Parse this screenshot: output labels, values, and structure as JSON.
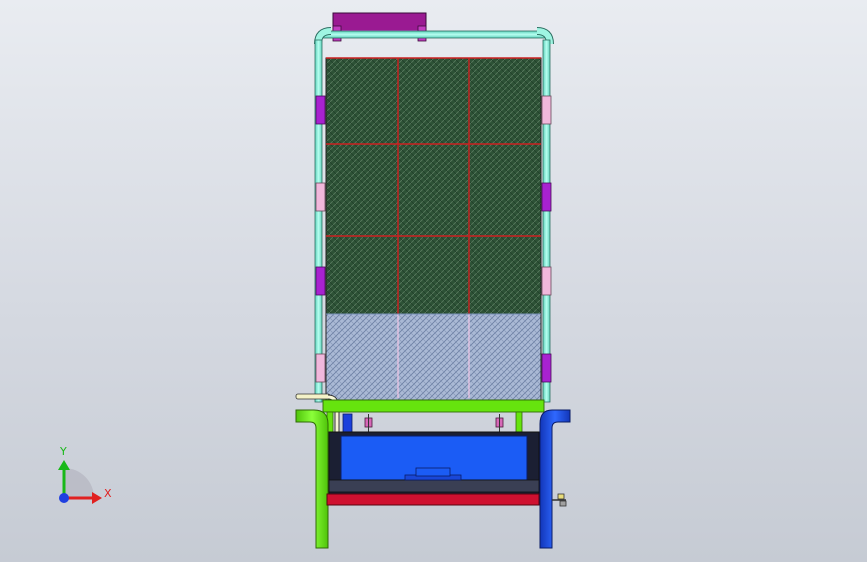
{
  "viewport": {
    "background_top": "#e9ecf1",
    "background_bottom": "#c6cbd4"
  },
  "triad": {
    "x_label": "X",
    "y_label": "Y",
    "x_color": "#e02020",
    "y_color": "#18b818",
    "z_color": "#1f3fe0"
  },
  "colors": {
    "frame_pipe": "#8cf0d8",
    "hinge_magenta": "#a822d0",
    "hinge_pink": "#f1b8dc",
    "top_bar": "#9a1a92",
    "grid_lines": "#cc2020",
    "filter_dark": "#2d5236",
    "filter_light": "#aab9d5",
    "left_leg": "#66e40e",
    "right_leg": "#1b4fe0",
    "tray_blue": "#1b5cf5",
    "base_red": "#cf1030"
  }
}
